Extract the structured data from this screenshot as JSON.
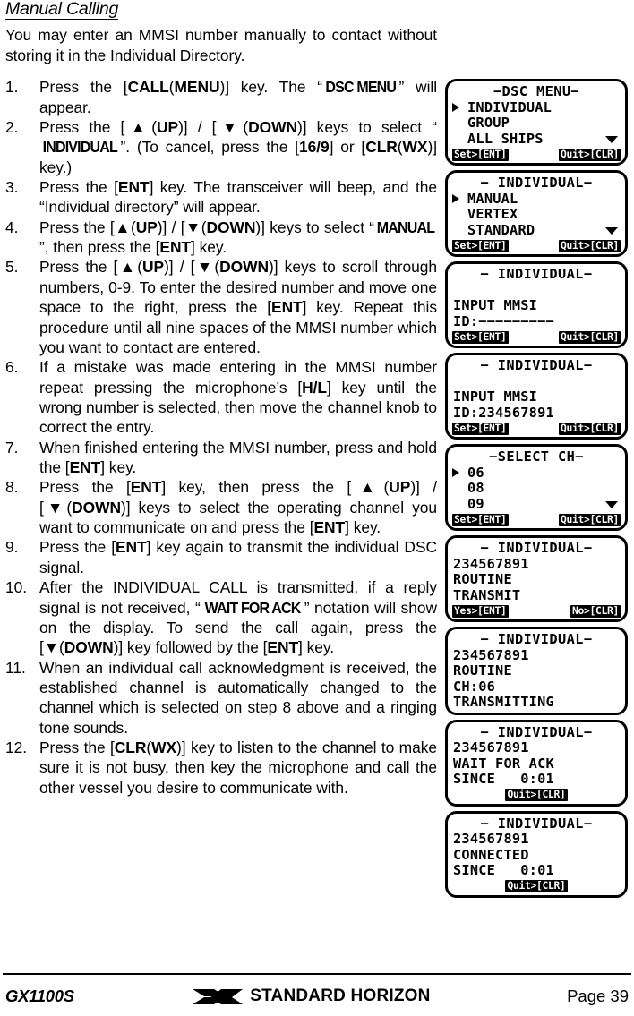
{
  "section": {
    "title": "Manual Calling",
    "intro": "You may enter an MMSI number manually to contact without storing it in the Individual Directory."
  },
  "steps": [
    {
      "num": "1.",
      "html": "Press the [<b>CALL</b>(<b>MENU</b>)] key. The “<span class='lcdname'>DSC MENU</span>” will appear."
    },
    {
      "num": "2.",
      "html": "Press the [<b>▲</b>(<b>UP</b>)] / [<b>▼</b>(<b>DOWN</b>)] keys to select “<span class='lcdname'>INDIVIDUAL</span>”. (To cancel, press the [<b>16/9</b>] or [<b>CLR</b>(<b>WX</b>)] key.)"
    },
    {
      "num": "3.",
      "html": "Press the [<b>ENT</b>] key. The transceiver will beep, and the “Individual directory” will appear."
    },
    {
      "num": "4.",
      "html": "Press the [<b>▲</b>(<b>UP</b>)] / [<b>▼</b>(<b>DOWN</b>)] keys to select “<span class='lcdname'>MANUAL</span>”, then press the [<b>ENT</b>] key."
    },
    {
      "num": "5.",
      "html": "Press the [<b>▲</b>(<b>UP</b>)] / [<b>▼</b>(<b>DOWN</b>)] keys to scroll through numbers, 0-9. To enter the desired number and move one space to the right, press the [<b>ENT</b>] key. Repeat this procedure until all nine spaces of the MMSI number which you want to contact are entered."
    },
    {
      "num": "6.",
      "html": "If a mistake was made entering in the MMSI number repeat pressing the microphone’s [<b>H/L</b>] key until the wrong number is selected, then move the channel knob to correct the entry."
    },
    {
      "num": "7.",
      "html": "When finished entering the MMSI number, press and hold the [<b>ENT</b>] key."
    },
    {
      "num": "8.",
      "html": "Press the [<b>ENT</b>] key, then press the [<b>▲</b>(<b>UP</b>)] / [<b>▼</b>(<b>DOWN</b>)] keys to select the operating channel you want to communicate on and press the [<b>ENT</b>] key."
    },
    {
      "num": "9.",
      "html": "Press the [<b>ENT</b>] key again to transmit the individual DSC signal."
    },
    {
      "num": "10.",
      "html": "After the INDIVIDUAL CALL is transmitted, if a reply signal is not received, “<span class='lcdname'>WAIT FOR ACK</span>” notation will show on the display. To send the call again, press the [<b>▼</b>(<b>DOWN</b>)] key followed by the [<b>ENT</b>] key."
    },
    {
      "num": "11.",
      "html": "When an individual call acknowledgment is received, the established channel is automatically changed to the channel which is selected on step 8 above and a ringing tone sounds."
    },
    {
      "num": "12.",
      "html": "Press the [<b>CLR</b>(<b>WX</b>)] key to listen to the channel to make sure it is not busy, then key the microphone and call the other vessel you desire to communicate with."
    }
  ],
  "lcd_screens": [
    {
      "name": "dsc-menu",
      "title": "−DSC MENU−",
      "lines": [
        {
          "text": "INDIVIDUAL",
          "cursor": true
        },
        {
          "text": "GROUP",
          "cursor": false
        },
        {
          "text": "ALL SHIPS",
          "cursor": false,
          "scroll_down": true
        }
      ],
      "footer_left": "Set>[ENT]",
      "footer_right": "Quit>[CLR]"
    },
    {
      "name": "individual-list",
      "title": "− INDIVIDUAL−",
      "lines": [
        {
          "text": "MANUAL",
          "cursor": true
        },
        {
          "text": "VERTEX",
          "cursor": false
        },
        {
          "text": "STANDARD",
          "cursor": false,
          "scroll_down": true
        }
      ],
      "footer_left": "Set>[ENT]",
      "footer_right": "Quit>[CLR]"
    },
    {
      "name": "input-mmsi-blank",
      "title": "− INDIVIDUAL−",
      "lines": [
        {
          "text": "",
          "blank": true
        },
        {
          "text": "INPUT MMSI"
        },
        {
          "text": "ID:−−−−−−−−−"
        }
      ],
      "footer_left": "Set>[ENT]",
      "footer_right": "Quit>[CLR]"
    },
    {
      "name": "input-mmsi-entered",
      "title": "− INDIVIDUAL−",
      "lines": [
        {
          "text": "",
          "blank": true
        },
        {
          "text": "INPUT MMSI"
        },
        {
          "text": "ID:234567891"
        }
      ],
      "footer_left": "Set>[ENT]",
      "footer_right": "Quit>[CLR]"
    },
    {
      "name": "select-ch",
      "title": "−SELECT CH−",
      "lines": [
        {
          "text": "06",
          "cursor": true
        },
        {
          "text": "08",
          "cursor": false
        },
        {
          "text": "09",
          "cursor": false,
          "scroll_down": true
        }
      ],
      "footer_left": "Set>[ENT]",
      "footer_right": "Quit>[CLR]"
    },
    {
      "name": "transmit-confirm",
      "title": "− INDIVIDUAL−",
      "lines": [
        {
          "text": "234567891"
        },
        {
          "text": "ROUTINE"
        },
        {
          "text": "TRANSMIT"
        }
      ],
      "footer_left": "Yes>[ENT]",
      "footer_right": "No>[CLR]"
    },
    {
      "name": "transmitting",
      "title": "− INDIVIDUAL−",
      "lines": [
        {
          "text": "234567891"
        },
        {
          "text": "ROUTINE"
        },
        {
          "text": "CH:06"
        },
        {
          "text": "TRANSMITTING"
        }
      ],
      "footer_left": "",
      "footer_right": ""
    },
    {
      "name": "wait-for-ack",
      "title": "− INDIVIDUAL−",
      "lines": [
        {
          "text": "234567891"
        },
        {
          "text": "WAIT FOR ACK"
        },
        {
          "text": "SINCE   0:01"
        }
      ],
      "footer_center": "Quit>[CLR]"
    },
    {
      "name": "connected",
      "title": "− INDIVIDUAL−",
      "lines": [
        {
          "text": "234567891"
        },
        {
          "text": "CONNECTED"
        },
        {
          "text": "SINCE   0:01"
        }
      ],
      "footer_center": "Quit>[CLR]"
    }
  ],
  "footer": {
    "model": "GX1100S",
    "brand": "STANDARD HORIZON",
    "page": "Page 39"
  }
}
